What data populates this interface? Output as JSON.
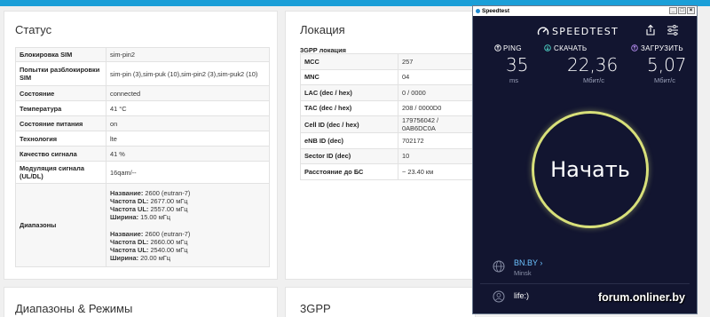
{
  "status": {
    "title": "Статус",
    "rows": [
      {
        "k": "Блокировка SIM",
        "v": "sim-pin2"
      },
      {
        "k": "Попытки разблокировки SIM",
        "v": "sim-pin (3),sim-puk (10),sim-pin2 (3),sim-puk2 (10)"
      },
      {
        "k": "Состояние",
        "v": "connected"
      },
      {
        "k": "Температура",
        "v": "41 °C"
      },
      {
        "k": "Состояние питания",
        "v": "on"
      },
      {
        "k": "Технология",
        "v": "lte"
      },
      {
        "k": "Качество сигнала",
        "v": "41 %"
      },
      {
        "k": "Модуляция сигнала (UL/DL)",
        "v": "16qam/--"
      }
    ],
    "bands_label": "Диапазоны",
    "bands": [
      {
        "name_k": "Название:",
        "name_v": "2600 (eutran-7)",
        "dl_k": "Частота DL:",
        "dl_v": "2677.00 мГц",
        "ul_k": "Частота UL:",
        "ul_v": "2557.00 мГц",
        "width_k": "Ширина:",
        "width_v": "15.00 мГц"
      },
      {
        "name_k": "Название:",
        "name_v": "2600 (eutran-7)",
        "dl_k": "Частота DL:",
        "dl_v": "2660.00 мГц",
        "ul_k": "Частота UL:",
        "ul_v": "2540.00 мГц",
        "width_k": "Ширина:",
        "width_v": "20.00 мГц"
      }
    ]
  },
  "location": {
    "title": "Локация",
    "sub_title": "3GPP локация",
    "rows": [
      {
        "k": "MCC",
        "v": "257"
      },
      {
        "k": "MNC",
        "v": "04"
      },
      {
        "k": "LAC (dec / hex)",
        "v": "0 / 0000"
      },
      {
        "k": "TAC (dec / hex)",
        "v": "208 / 0000D0"
      },
      {
        "k": "Cell ID (dec / hex)",
        "v": "179756042 / 0AB6DC0A"
      },
      {
        "k": "eNB ID (dec)",
        "v": "702172"
      },
      {
        "k": "Sector ID (dec)",
        "v": "10"
      },
      {
        "k": "Расстояние до БС",
        "v": "~ 23.40 км"
      }
    ]
  },
  "bottom": {
    "bands_modes_title": "Диапазоны & Режимы",
    "gpp_title": "3GPP"
  },
  "speedtest": {
    "window_title": "Speedtest",
    "brand": "SPEEDTEST",
    "ping_label": "PING",
    "ping_value": "35",
    "ping_unit": "ms",
    "download_label": "СКАЧАТЬ",
    "download_value": "22,36",
    "download_unit": "Мбит/с",
    "upload_label": "ЗАГРУЗИТЬ",
    "upload_value": "5,07",
    "upload_unit": "Мбит/с",
    "go_label": "Начать",
    "isp_name": "BN.BY",
    "isp_city": "Minsk",
    "isp2_name": "life:)",
    "colors": {
      "bg": "#121530",
      "ring": "#d8e07a",
      "download": "#4fd6c8",
      "upload": "#b58cf0",
      "isp": "#6cc2ff"
    }
  },
  "watermark": "forum.onliner.by"
}
